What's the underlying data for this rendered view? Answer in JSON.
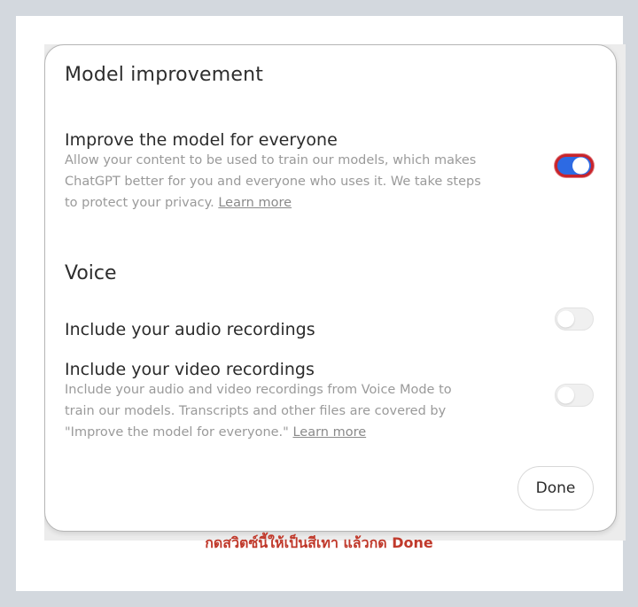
{
  "dialog": {
    "section_title": "Model improvement",
    "improve": {
      "label": "Improve the model for everyone",
      "desc": "Allow your content to be used to train our models, which makes ChatGPT better for you and everyone who uses it. We take steps to protect your privacy.",
      "link": "Learn more",
      "toggle_state": "on"
    },
    "voice": {
      "title": "Voice",
      "audio_label": "Include your audio recordings",
      "audio_toggle_state": "off",
      "video_label": "Include your video recordings",
      "video_desc": "Include your audio and video recordings from Voice Mode to train our models. Transcripts and other files are covered by \"Improve the model for everyone.\"",
      "video_link": "Learn more",
      "video_toggle_state": "off"
    },
    "done_label": "Done"
  },
  "caption": "กดสวิตซ์นี้ให้เป็นสีเทา แล้วกด Done",
  "colors": {
    "toggle_on": "#2d6ae3",
    "highlight_ring": "#c8242b",
    "caption": "#c0392b"
  }
}
